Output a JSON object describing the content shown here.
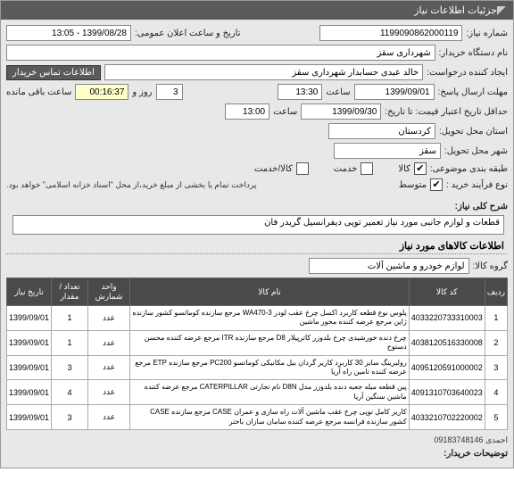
{
  "header": {
    "title": "جزئیات اطلاعات نیاز"
  },
  "form": {
    "req_no_label": "شماره نیاز:",
    "req_no": "1199090862000119",
    "ann_label": "تاریخ و ساعت اعلان عمومی:",
    "ann_value": "1399/08/28 - 13:05",
    "buyer_label": "نام دستگاه خریدار:",
    "buyer": "شهرداری سقز",
    "creator_label": "ایجاد کننده درخواست:",
    "creator": "خالد عبدی حسابدار شهرداری سقز",
    "contact_btn": "اطلاعات تماس خریدار",
    "resp_deadline_label": "مهلت ارسال پاسخ:",
    "resp_date": "1399/09/01",
    "resp_time_label": "ساعت",
    "resp_time": "13:30",
    "days_label": "روز و",
    "days": "3",
    "hms": "00:16:37",
    "remain_label": "ساعت باقی مانده",
    "price_valid_label": "حداقل تاریخ اعتبار قیمت: تا تاریخ:",
    "price_date": "1399/09/30",
    "price_time_label": "ساعت",
    "price_time": "13:00",
    "province_label": "استان محل تحویل:",
    "province": "کردستان",
    "city_label": "شهر محل تحویل:",
    "city": "سقز",
    "budget_label": "طبقه بندی موضوعی:",
    "goods_check": "✔",
    "goods_label": "کالا",
    "service_check": "",
    "service_label": "خدمت",
    "goods_service_check": "",
    "goods_service_label": "کالا/خدمت",
    "process_label": "نوع فرآیند خرید :",
    "medium_check": "✔",
    "medium_label": "متوسط",
    "note": "پرداخت تمام یا بخشی از مبلغ خرید،از محل \"اسناد خزانه اسلامی\" خواهد بود.",
    "desc_label": "شرح کلی نیاز:",
    "desc": "قطعات و لوازم جانبی مورد نیاز تعمیر توپی دیفرانسیل گریدر فان",
    "items_title": "اطلاعات کالاهای مورد نیاز",
    "group_label": "گروه کالا:",
    "group": "لوازم خودرو و ماشین آلات"
  },
  "table": {
    "headers": {
      "row": "ردیف",
      "code": "کد کالا",
      "name": "نام کالا",
      "unit": "واحد شمارش",
      "qty": "تعداد / مقدار",
      "date": "تاریخ نیاز"
    },
    "rows": [
      {
        "n": "1",
        "code": "4033220733310003",
        "name": "پلوس نوع قطعه کاربرد اکسل چرخ عقب لودر WA470-3 مرجع سازنده کوماتسو کشور سازنده ژاپن مرجع عرضه کننده محور ماشین",
        "unit": "عدد",
        "qty": "1",
        "date": "1399/09/01"
      },
      {
        "n": "2",
        "code": "4038120516330008",
        "name": "چرخ دنده خورشیدی چرخ بلدوزر کاترپیلار D8 مرجع سازنده ITR مرجع عرضه کننده محسن دستوح",
        "unit": "عدد",
        "qty": "1",
        "date": "1399/09/01"
      },
      {
        "n": "3",
        "code": "4095120591000002",
        "name": "رولبرینگ سایز 30 کاربرد کاریر گردان بیل مکانیکی کوماتسو PC200 مرجع سازنده ETP مرجع عرضه کننده تامین راه آریا",
        "unit": "عدد",
        "qty": "3",
        "date": "1399/09/01"
      },
      {
        "n": "4",
        "code": "4091310703640023",
        "name": "پین قطعه میله جعبه دنده بلدوزر مدل D8N نام تجارتی CATERPILLAR مرجع عرضه کننده ماشین سنگین آریا",
        "unit": "عدد",
        "qty": "4",
        "date": "1399/09/01"
      },
      {
        "n": "5",
        "code": "4033210702220002",
        "name": "کاریر کامل توپی چرخ عقب ماشین آلات راه سازی و عمران CASE مرجع سازنده CASE کشور سازنده فرانسه مرجع عرضه کننده سامان سازان باختر",
        "unit": "عدد",
        "qty": "3",
        "date": "1399/09/01"
      }
    ]
  },
  "footer": {
    "person": "احمدی 09183748146",
    "comment_label": "توضیحات خریدار:"
  }
}
